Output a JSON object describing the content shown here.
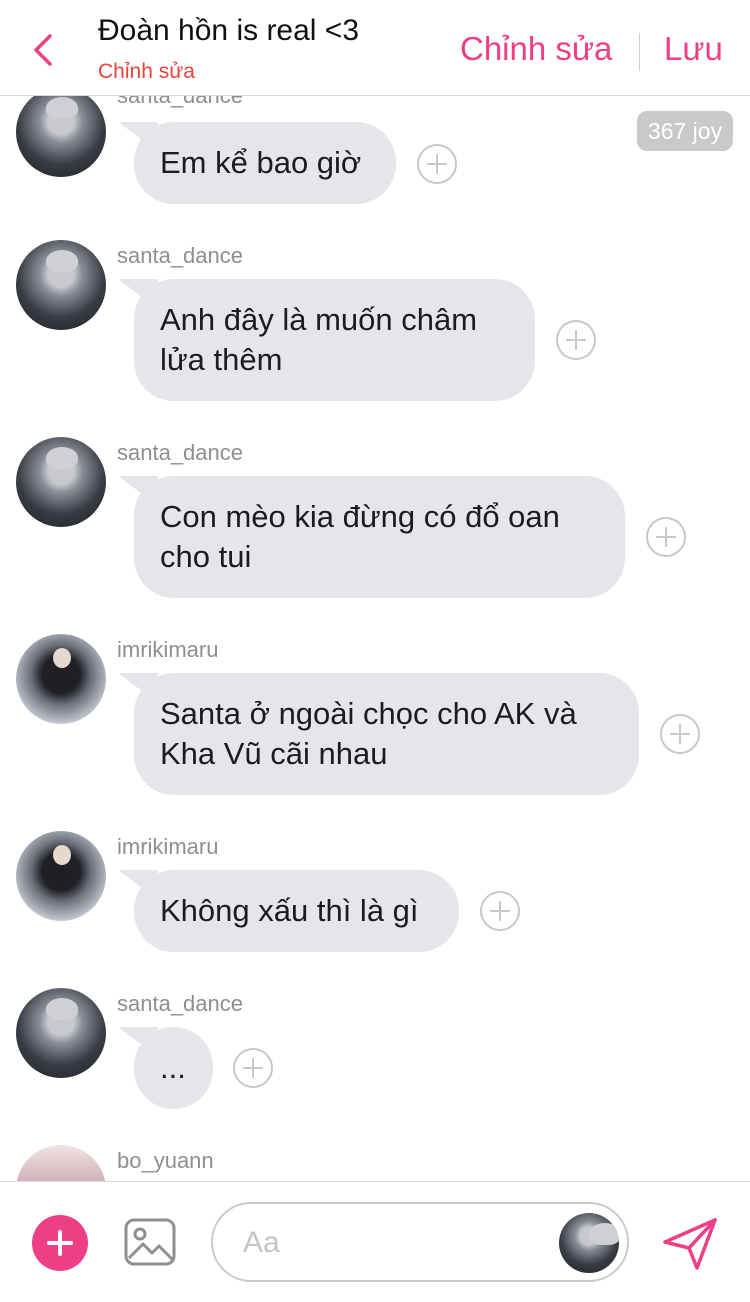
{
  "header": {
    "title": "Đoàn hồn is real <3",
    "subtitle": "Chỉnh sửa",
    "edit_label": "Chỉnh sửa",
    "save_label": "Lưu",
    "accent_color": "#ee3f86",
    "subtitle_color": "#e8433a"
  },
  "badge": {
    "text": "367 joy"
  },
  "messages": [
    {
      "username": "santa_dance",
      "lines": [
        "Em kể bao giờ"
      ],
      "avatar": "santa-avatar"
    },
    {
      "username": "santa_dance",
      "lines": [
        "Anh đây là muốn châm",
        "lửa thêm"
      ],
      "avatar": "santa-avatar"
    },
    {
      "username": "santa_dance",
      "lines": [
        "Con mèo kia đừng có đổ oan",
        "cho tui"
      ],
      "avatar": "santa-avatar"
    },
    {
      "username": "imrikimaru",
      "lines": [
        "Santa ở ngoài chọc cho AK và",
        "Kha Vũ cãi nhau"
      ],
      "avatar": "imri-avatar"
    },
    {
      "username": "imrikimaru",
      "lines": [
        "Không xấu thì là gì"
      ],
      "avatar": "imri-avatar"
    },
    {
      "username": "santa_dance",
      "lines": [
        "..."
      ],
      "avatar": "santa-avatar"
    },
    {
      "username": "bo_yuann",
      "lines": [],
      "avatar": "bo-avatar"
    }
  ],
  "composer": {
    "placeholder": "Aa",
    "icons": [
      "plus-icon",
      "image-icon",
      "send-icon"
    ]
  },
  "bubble_color": "#e4e6ea"
}
